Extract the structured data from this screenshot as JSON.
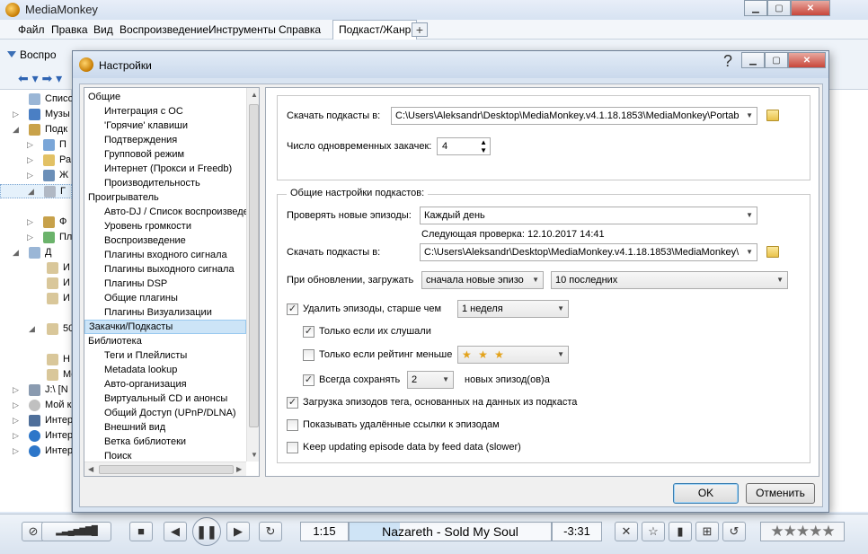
{
  "app": {
    "title": "MediaMonkey",
    "menu": [
      "Файл",
      "Правка",
      "Вид",
      "Воспроизведение",
      "Инструменты",
      "Справка"
    ],
    "active_tab": "Подкаст/Жанр",
    "add_tab": "+",
    "toolbar_text": "Воспро",
    "tree": [
      "Списо",
      "Музы",
      "Подк",
      "П",
      "Ра",
      "Ж",
      "Г",
      "Ф",
      "Плей",
      "Д",
      "И",
      "И",
      "И",
      "50",
      "Н",
      "Меди",
      "J:\\ [N",
      "Мой к",
      "Интер",
      "Интер"
    ]
  },
  "player": {
    "elapsed": "1:15",
    "track": "Nazareth - Sold My Soul",
    "remaining": "-3:31",
    "progress_fraction": 0.25
  },
  "dialog": {
    "title": "Настройки",
    "help": "?",
    "nav": [
      {
        "label": "Общие",
        "level": 0
      },
      {
        "label": "Интеграция с ОС",
        "level": 1
      },
      {
        "label": "'Горячие' клавиши",
        "level": 1
      },
      {
        "label": "Подтверждения",
        "level": 1
      },
      {
        "label": "Групповой режим",
        "level": 1
      },
      {
        "label": "Интернет (Прокси и Freedb)",
        "level": 1
      },
      {
        "label": "Производительность",
        "level": 1
      },
      {
        "label": "Проигрыватель",
        "level": 0
      },
      {
        "label": "Авто-DJ / Список воспроизведения",
        "level": 1
      },
      {
        "label": "Уровень громкости",
        "level": 1
      },
      {
        "label": "Воспроизведение",
        "level": 1
      },
      {
        "label": "Плагины входного сигнала",
        "level": 1
      },
      {
        "label": "Плагины выходного сигнала",
        "level": 1
      },
      {
        "label": "Плагины DSP",
        "level": 1
      },
      {
        "label": "Общие плагины",
        "level": 1
      },
      {
        "label": "Плагины Визуализации",
        "level": 1
      },
      {
        "label": "Закачки/Подкасты",
        "level": 0,
        "selected": true
      },
      {
        "label": "Библиотека",
        "level": 0
      },
      {
        "label": "Теги и Плейлисты",
        "level": 1
      },
      {
        "label": "Metadata lookup",
        "level": 1
      },
      {
        "label": "Авто-организация",
        "level": 1
      },
      {
        "label": "Виртуальный CD и анонсы",
        "level": 1
      },
      {
        "label": "Общий Доступ (UPnP/DLNA)",
        "level": 1
      },
      {
        "label": "Внешний вид",
        "level": 1
      },
      {
        "label": "Ветка библиотеки",
        "level": 1
      },
      {
        "label": "Поиск",
        "level": 1
      }
    ],
    "downloads": {
      "path_label": "Скачать подкасты в:",
      "path_value": "C:\\Users\\Aleksandr\\Desktop\\MediaMonkey.v4.1.18.1853\\MediaMonkey\\Portab",
      "concurrent_label": "Число одновременных закачек:",
      "concurrent_value": "4"
    },
    "podcast_settings": {
      "group_title": "Общие настройки подкастов:",
      "check_label": "Проверять новые эпизоды:",
      "check_value": "Каждый день",
      "next_check": "Следующая проверка: 12.10.2017 14:41",
      "path_label": "Скачать подкасты в:",
      "path_value": "C:\\Users\\Aleksandr\\Desktop\\MediaMonkey.v4.1.18.1853\\MediaMonkey\\",
      "on_update_label": "При обновлении, загружать",
      "on_update_value": "сначала новые эпизо",
      "on_update_count": "10 последних",
      "delete_label": "Удалить эпизоды, старше чем",
      "delete_checked": true,
      "delete_value": "1 неделя",
      "only_listened_label": "Только если их слушали",
      "only_listened_checked": true,
      "only_rating_label": "Только если рейтинг меньше",
      "only_rating_checked": false,
      "rating_stars": "★ ★ ★",
      "rating_value": 3,
      "always_keep_label": "Всегда сохранять",
      "always_keep_checked": true,
      "always_keep_value": "2",
      "always_keep_suffix": "новых эпизод(ов)а",
      "tag_label": "Загрузка эпизодов тега, основанных на данных из подкаста",
      "tag_checked": true,
      "show_deleted_label": "Показывать удалённые ссылки к эпизодам",
      "show_deleted_checked": false,
      "keep_updating_label": "Keep updating episode data by feed data (slower)",
      "keep_updating_checked": false
    },
    "ok": "OK",
    "cancel": "Отменить"
  }
}
